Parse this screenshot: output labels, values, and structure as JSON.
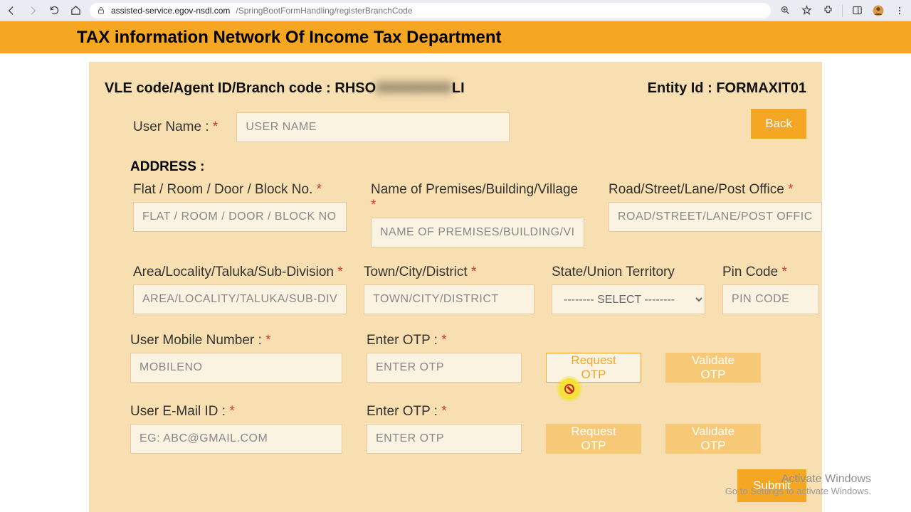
{
  "browser": {
    "url_host": "assisted-service.egov-nsdl.com",
    "url_path": "/SpringBootFormHandling/registerBranchCode"
  },
  "banner": {
    "title": "TAX information Network Of Income Tax Department"
  },
  "header": {
    "vle_label": "VLE code/Agent ID/Branch code :",
    "vle_value_prefix": "RHSO",
    "vle_value_blur": "XXXXXXXX",
    "vle_value_suffix": "LI",
    "entity_label": "Entity Id :",
    "entity_value": "FORMAXIT01"
  },
  "actions": {
    "back": "Back",
    "submit": "Submit"
  },
  "user": {
    "name_label": "User Name :",
    "name_placeholder": "USER NAME"
  },
  "address": {
    "section": "ADDRESS :",
    "flat_label": "Flat / Room / Door / Block No.",
    "flat_placeholder": "FLAT / ROOM / DOOR / BLOCK NO.",
    "premises_label": "Name of Premises/Building/Village",
    "premises_placeholder": "NAME OF PREMISES/BUILDING/VILLAGE",
    "road_label": "Road/Street/Lane/Post Office",
    "road_placeholder": "ROAD/STREET/LANE/POST OFFICE",
    "area_label": "Area/Locality/Taluka/Sub-Division",
    "area_placeholder": "AREA/LOCALITY/TALUKA/SUB-DIVISION",
    "city_label": "Town/City/District",
    "city_placeholder": "TOWN/CITY/DISTRICT",
    "state_label": "State/Union Territory",
    "state_placeholder": "-------- SELECT --------",
    "pin_label": "Pin Code",
    "pin_placeholder": "PIN CODE"
  },
  "mobile": {
    "label": "User Mobile Number :",
    "placeholder": "MOBILENO",
    "otp_label": "Enter OTP :",
    "otp_placeholder": "ENTER OTP",
    "request": "Request OTP",
    "validate": "Validate OTP"
  },
  "email": {
    "label": "User E-Mail ID :",
    "placeholder": "EG: ABC@GMAIL.COM",
    "otp_label": "Enter OTP :",
    "otp_placeholder": "ENTER OTP",
    "request": "Request OTP",
    "validate": "Validate OTP"
  },
  "watermark": {
    "title": "Activate Windows",
    "sub": "Go to Settings to activate Windows."
  }
}
